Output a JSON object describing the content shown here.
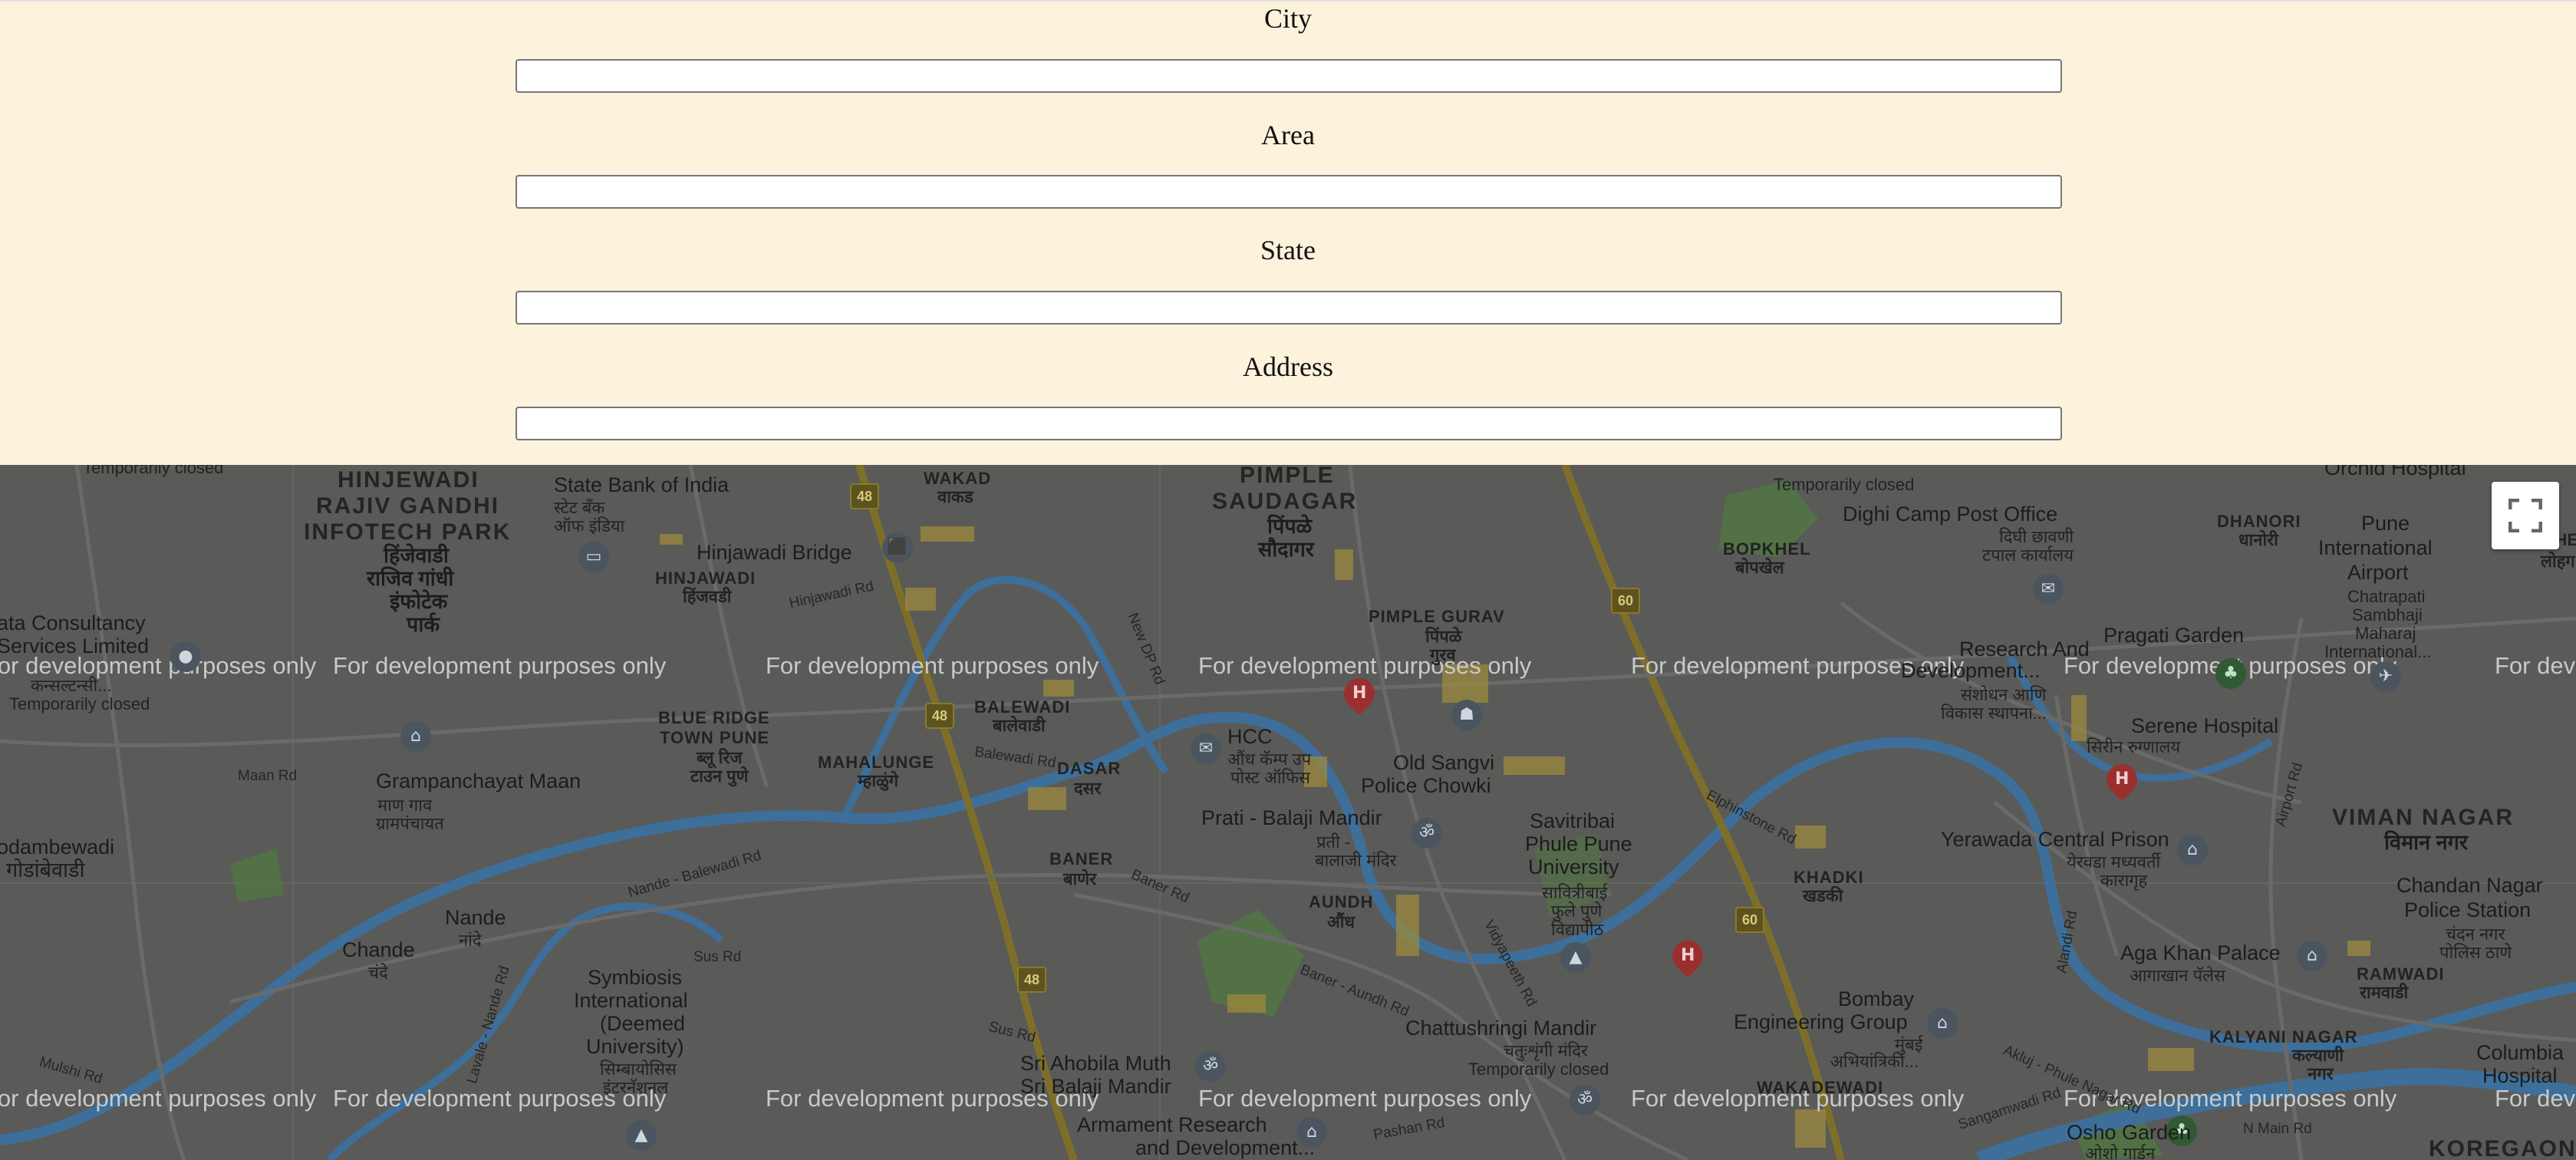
{
  "form": {
    "fields": [
      {
        "label": "City",
        "value": "",
        "placeholder": ""
      },
      {
        "label": "Area",
        "value": "",
        "placeholder": ""
      },
      {
        "label": "State",
        "value": "",
        "placeholder": ""
      },
      {
        "label": "Address",
        "value": "",
        "placeholder": ""
      }
    ]
  },
  "map": {
    "watermark": "For development purposes only",
    "fullscreen_icon": "fullscreen-icon",
    "labels": {
      "temporarily_closed_1": "Temporarily closed",
      "hinjewadi": "HINJEWADI",
      "rajiv_gandhi": "RAJIV GANDHI",
      "infotech_park": "INFOTECH PARK",
      "hinjewadi_mr1": "हिंजेवाडी",
      "rajiv_gandhi_mr": "राजिव गांधी",
      "infotech_mr": "इंफोटेक",
      "park_mr": "पार्क",
      "sbi": "State Bank of India",
      "sbi_mr1": "स्टेट बँक",
      "sbi_mr2": "ऑफ इंडिया",
      "hinjawadi_bridge": "Hinjawadi Bridge",
      "hinjawadi_area": "HINJAWADI",
      "hinjawadi_area_mr": "हिंजवडी",
      "wakad": "WAKAD",
      "wakad_mr": "वाकड",
      "pimple_saudagar": "PIMPLE",
      "saudagar": "SAUDAGAR",
      "pimple_mr": "पिंपळे",
      "saudagar_mr": "सौदागर",
      "tata": "ata Consultancy",
      "tata2": "Services Limited",
      "tata_mr": "कन्सल्टन्सी...",
      "temporarily_closed_2": "Temporarily closed",
      "pimple_gurav": "PIMPLE GURAV",
      "pimple_gurav_mr1": "पिंपळे",
      "pimple_gurav_mr2": "गुरव",
      "bopkhel": "BOPKHEL",
      "bopkhel_mr": "बोपखेल",
      "temporarily_closed_3": "Temporarily closed",
      "dighi": "Dighi Camp Post Office",
      "dighi_mr1": "दिघी छावणी",
      "dighi_mr2": "टपाल कार्यालय",
      "dhanori": "DHANORI",
      "dhanori_mr": "धानोरी",
      "pune_airport1": "Pune",
      "pune_airport2": "International",
      "pune_airport3": "Airport",
      "pune_airport4": "Chatrapati",
      "pune_airport5": "Sambhaji",
      "pune_airport6": "Maharaj",
      "pune_airport7": "International...",
      "orchid": "Orchid Hospital",
      "pragati": "Pragati Garden",
      "research1": "Research And",
      "research2": "Development...",
      "research_mr1": "संशोधन आणि",
      "research_mr2": "विकास स्थापना...",
      "serene": "Serene Hospital",
      "serene_mr": "सिरीन रुग्णालय",
      "viman_nagar": "VIMAN NAGAR",
      "viman_nagar_mr": "विमान नगर",
      "chandan1": "Chandan Nagar",
      "chandan2": "Police Station",
      "chandan_mr1": "चंदन नगर",
      "chandan_mr2": "पोलिस ठाणे",
      "yerawada": "Yerawada Central Prison",
      "yerawada_mr1": "येरवडा मध्यवर्ती",
      "yerawada_mr2": "कारागृह",
      "blue_ridge1": "BLUE RIDGE",
      "blue_ridge2": "TOWN PUNE",
      "blue_ridge_mr1": "ब्लू रिज",
      "blue_ridge_mr2": "टाउन पुणे",
      "balewadi": "BALEWADI",
      "balewadi_mr": "बालेवाडी",
      "mahalunge": "MAHALUNGE",
      "mahalunge_mr": "म्हाळुंगे",
      "dasar": "DASAR",
      "dasar_mr": "दसर",
      "hcc": "HCC",
      "hcc_mr1": "औंध कॅम्प उप",
      "hcc_mr2": "पोस्ट ऑफिस",
      "old_sangvi1": "Old Sangvi",
      "old_sangvi2": "Police Chowki",
      "grampanchayat": "Grampanchayat Maan",
      "grampanchayat_mr1": "माण गाव",
      "grampanchayat_mr2": "ग्रामपंचायत",
      "temporarily_closed_4": "Temporarily closed",
      "godambewadi": "odambewadi",
      "godambewadi_mr": "गोडांबेवाडी",
      "prati": "Prati - Balaji Mandir",
      "prati_mr1": "प्रती -",
      "prati_mr2": "बालाजी मंदिर",
      "savitribai1": "Savitribai",
      "savitribai2": "Phule Pune",
      "savitribai3": "University",
      "savitribai_mr1": "सावित्रीबाई",
      "savitribai_mr2": "फुले पुणे",
      "savitribai_mr3": "विद्यापीठ",
      "baner": "BANER",
      "baner_mr": "बाणेर",
      "aundh": "AUNDH",
      "aundh_mr": "औंध",
      "khadki": "KHADKI",
      "khadki_mr": "खडकी",
      "nande": "Nande",
      "nande_mr": "नांदे",
      "chande": "Chande",
      "chande_mr": "चंदे",
      "symbiosis1": "Symbiosis",
      "symbiosis2": "International",
      "symbiosis3": "(Deemed",
      "symbiosis4": "University)",
      "symbiosis_mr1": "सिम्बायोसिस",
      "symbiosis_mr2": "इंटरनॅशनल",
      "chattushringi": "Chattushringi Mandir",
      "chattushringi_mr": "चतुःशृंगी मंदिर",
      "temporarily_closed_5": "Temporarily closed",
      "bombay1": "Bombay",
      "bombay2": "Engineering Group",
      "bombay_mr1": "मुंबई",
      "bombay_mr2": "अभियांत्रिकी...",
      "aga_khan": "Aga Khan Palace",
      "aga_khan_mr": "आगाखान पॅलेस",
      "ramwadi": "RAMWADI",
      "ramwadi_mr": "रामवाडी",
      "kalyani1": "KALYANI NAGAR",
      "kalyani_mr1": "कल्याणी",
      "kalyani_mr2": "नगर",
      "columbia1": "Columbia",
      "columbia2": "Hospital",
      "sri_ahobila1": "Sri Ahobila Muth",
      "sri_ahobila2": "Sri Balaji Mandir",
      "armament1": "Armament Research",
      "armament2": "and Development...",
      "wakadewadi": "WAKADEWADI",
      "osho": "Osho Garden",
      "osho_mr": "ओशो गार्डन",
      "koregaon": "KOREGAON",
      "lohegaon": "लोहग",
      "loheg": "LOHEG",
      "r_maan": "Maan Rd",
      "r_balewadi": "Balewadi Rd",
      "r_hinjawadi": "Hinjawadi Rd",
      "r_nande_balewadi": "Nande - Balewadi Rd",
      "r_baner": "Baner Rd",
      "r_baner_aundh": "Baner - Aundh Rd",
      "r_sus": "Sus Rd",
      "r_sus2": "Sus Rd",
      "r_lavale": "Lavale - Nande Rd",
      "r_mulshi": "Mulshi Rd",
      "r_vidyapeeth": "Vidyapeeth Rd",
      "r_elphinstone": "Elphinstone Rd",
      "r_alandi": "Alandi Rd",
      "r_airport": "Airport Rd",
      "r_akluj": "Akluj - Phule Nagar Rd",
      "r_pashan": "Pashan Rd",
      "r_sangamwadi": "Sangamwadi Rd",
      "r_n_main": "N Main Rd",
      "r_new_dp": "New DP Rd",
      "nh48": "48",
      "nh60": "60"
    },
    "colors": {
      "map_bg": "#5a5a58",
      "river": "#3d6f9a",
      "park": "#4e7a3e",
      "highway": "#8a7a2a",
      "highlight": "#9c8a3c",
      "watermark": "#c9c9c9"
    }
  }
}
